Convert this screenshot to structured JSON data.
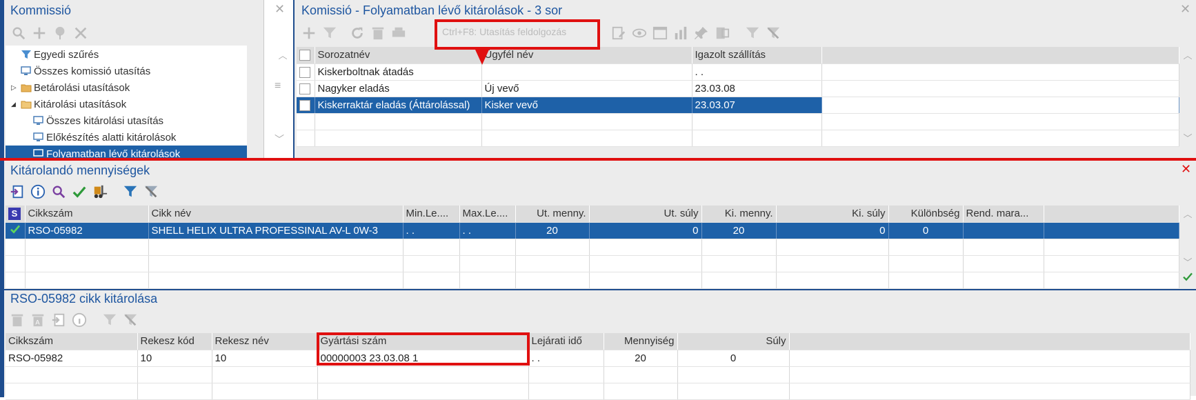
{
  "left_panel": {
    "title": "Kommissió",
    "close": "✕",
    "tree": [
      {
        "label": "Egyedi szűrés",
        "icon": "filter-icon"
      },
      {
        "label": "Összes komissió utasítás",
        "icon": "monitor-icon"
      },
      {
        "label": "Betárolási utasítások",
        "icon": "folder-icon",
        "expander": "▷"
      },
      {
        "label": "Kitárolási utasítások",
        "icon": "folder-open-icon",
        "expander": "◢"
      },
      {
        "label": "Összes kitárolási utasítás",
        "icon": "monitor-icon"
      },
      {
        "label": "Előkészítés alatti kitárolások",
        "icon": "monitor-icon"
      },
      {
        "label": "Folyamatban lévő kitárolások",
        "icon": "monitor-icon"
      }
    ]
  },
  "top_panel": {
    "title": "Komissió - Folyamatban lévő kitárolások - 3 sor",
    "close": "✕",
    "hint": "Ctrl+F8: Utasítás feldolgozás",
    "headers": [
      "Sorozatnév",
      "Ügyfél név",
      "Igazolt szállítás"
    ],
    "rows": [
      [
        "Kiskerboltnak átadás",
        "",
        ". ."
      ],
      [
        "Nagyker eladás",
        "Új vevő",
        "23.03.08"
      ],
      [
        "Kiskerraktár eladás (Áttárolással)",
        "Kisker vevő",
        "23.03.07"
      ]
    ]
  },
  "mid_panel": {
    "title": "Kitárolandó mennyiségek",
    "close": "✕",
    "sel_badge": "S",
    "headers": [
      "Cikkszám",
      "Cikk név",
      "Min.Le....",
      "Max.Le....",
      "Ut. menny.",
      "Ut. súly",
      "Ki. menny.",
      "Ki. súly",
      "Különbség",
      "Rend. mara..."
    ],
    "row": [
      "RSO-05982",
      "SHELL HELIX ULTRA PROFESSINAL AV-L 0W-3",
      ". .",
      ". .",
      "20",
      "0",
      "20",
      "0",
      "0",
      ""
    ]
  },
  "bottom_panel": {
    "title": "RSO-05982 cikk kitárolása",
    "headers": [
      "Cikkszám",
      "Rekesz kód",
      "Rekesz név",
      "Gyártási szám",
      "Lejárati idő",
      "Mennyiség",
      "Súly"
    ],
    "row": [
      "RSO-05982",
      "10",
      "10",
      "00000003 23.03.08 1",
      ". .",
      "20",
      "0"
    ]
  },
  "colors": {
    "accent": "#1e56a0",
    "selection": "#1e61a8",
    "annotation": "#e01010"
  }
}
